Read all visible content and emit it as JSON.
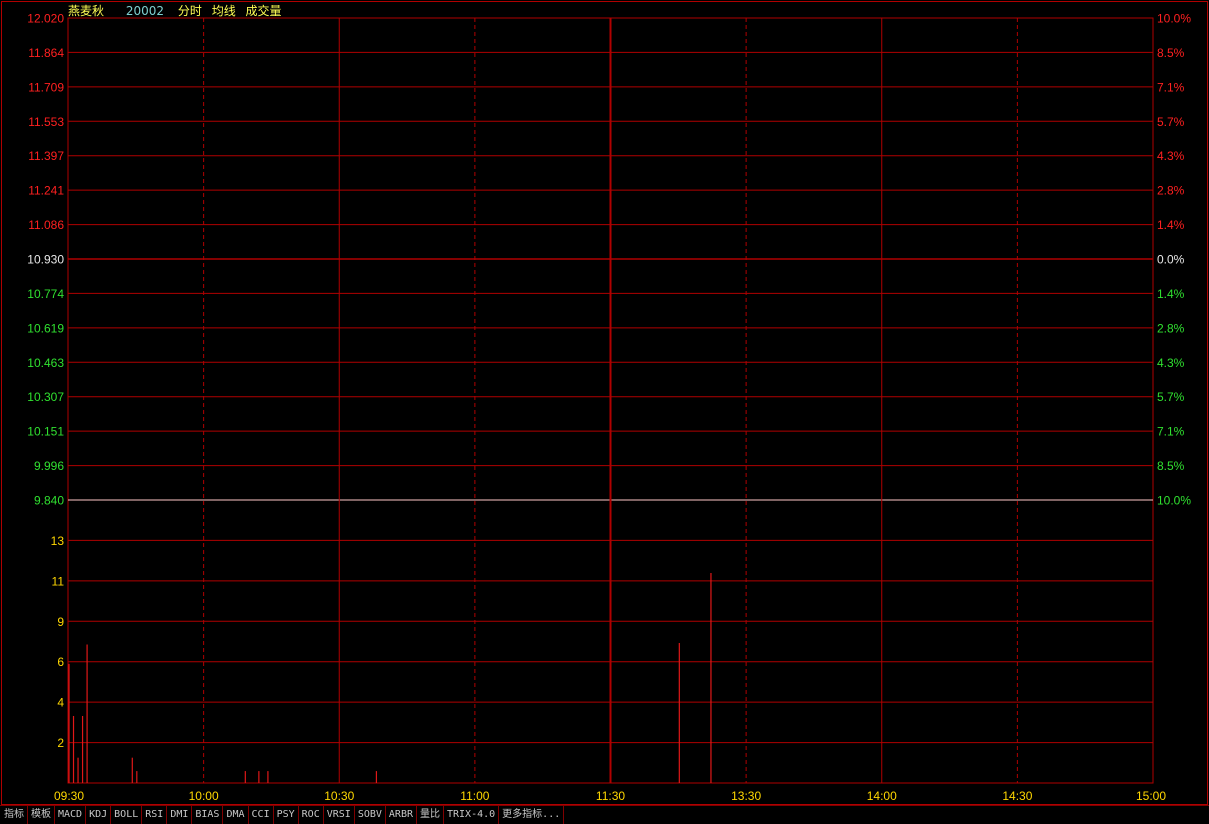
{
  "header": {
    "stock_name": "燕麦秋",
    "stock_code": "20002",
    "labels": [
      "分时",
      "均线",
      "成交量"
    ]
  },
  "colors": {
    "grid": "#b00000",
    "up": "#ff2020",
    "down": "#30e030",
    "flat": "#e8e8e8",
    "volume_label": "#ffd700",
    "time_label": "#ffd700",
    "volume_bar": "#e01818",
    "limit_line": "#ffc8c8"
  },
  "chart_data": {
    "type": "bar",
    "price_axis": {
      "ticks": [
        "12.020",
        "11.864",
        "11.709",
        "11.553",
        "11.397",
        "11.241",
        "11.086",
        "10.930",
        "10.774",
        "10.619",
        "10.463",
        "10.307",
        "10.151",
        "9.996",
        "9.840"
      ],
      "pct_ticks": [
        "10.0%",
        "8.5%",
        "7.1%",
        "5.7%",
        "4.3%",
        "2.8%",
        "1.4%",
        "0.0%",
        "1.4%",
        "2.8%",
        "4.3%",
        "5.7%",
        "7.1%",
        "8.5%",
        "10.0%"
      ],
      "prev_close": "10.930",
      "ylim": [
        9.84,
        12.02
      ]
    },
    "volume_axis": {
      "ticks": [
        "13",
        "11",
        "9",
        "6",
        "4",
        "2"
      ],
      "ylim": [
        0,
        19
      ]
    },
    "x_axis": {
      "ticks": [
        "09:30",
        "10:00",
        "10:30",
        "11:00",
        "11:30",
        "13:30",
        "14:00",
        "14:30",
        "15:00"
      ]
    },
    "volume_bars": [
      {
        "minute": 0,
        "value": 8
      },
      {
        "minute": 1,
        "value": 4.5
      },
      {
        "minute": 2,
        "value": 1.7
      },
      {
        "minute": 3,
        "value": 4.5
      },
      {
        "minute": 4,
        "value": 9.3
      },
      {
        "minute": 14,
        "value": 1.7
      },
      {
        "minute": 15,
        "value": 0.8
      },
      {
        "minute": 39,
        "value": 0.8
      },
      {
        "minute": 42,
        "value": 0.8
      },
      {
        "minute": 44,
        "value": 0.8
      },
      {
        "minute": 68,
        "value": 0.8
      },
      {
        "minute": 135,
        "value": 9.4
      },
      {
        "minute": 142,
        "value": 14.1
      }
    ]
  },
  "toolbar": {
    "tabs": [
      "指标",
      "模板",
      "MACD",
      "KDJ",
      "BOLL",
      "RSI",
      "DMI",
      "BIAS",
      "DMA",
      "CCI",
      "PSY",
      "ROC",
      "VRSI",
      "SOBV",
      "ARBR",
      "量比",
      "TRIX-4.0",
      "更多指标..."
    ]
  }
}
